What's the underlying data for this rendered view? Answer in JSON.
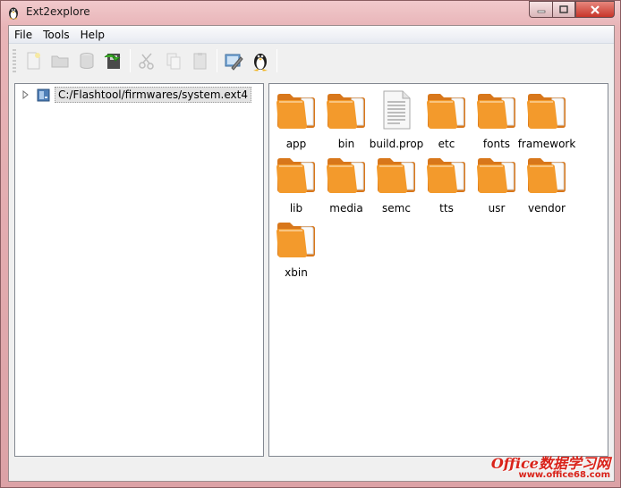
{
  "window": {
    "title": "Ext2explore"
  },
  "menu": {
    "items": [
      "File",
      "Tools",
      "Help"
    ]
  },
  "toolbar": {
    "buttons": [
      {
        "icon": "new-file-icon",
        "enabled": false
      },
      {
        "icon": "folder-icon",
        "enabled": false
      },
      {
        "icon": "disk-icon",
        "enabled": false
      },
      {
        "icon": "save-icon",
        "enabled": true
      },
      {
        "icon": "cut-icon",
        "enabled": false
      },
      {
        "icon": "copy-icon",
        "enabled": false
      },
      {
        "icon": "paste-icon",
        "enabled": false
      },
      {
        "icon": "settings-icon",
        "enabled": true
      },
      {
        "icon": "linux-penguin-icon",
        "enabled": true
      }
    ]
  },
  "tree": {
    "root_path": "C:/Flashtool/firmwares/system.ext4"
  },
  "files": [
    {
      "name": "app",
      "type": "folder"
    },
    {
      "name": "bin",
      "type": "folder"
    },
    {
      "name": "build.prop",
      "type": "file"
    },
    {
      "name": "etc",
      "type": "folder"
    },
    {
      "name": "fonts",
      "type": "folder"
    },
    {
      "name": "framework",
      "type": "folder"
    },
    {
      "name": "lib",
      "type": "folder"
    },
    {
      "name": "media",
      "type": "folder"
    },
    {
      "name": "semc",
      "type": "folder"
    },
    {
      "name": "tts",
      "type": "folder"
    },
    {
      "name": "usr",
      "type": "folder"
    },
    {
      "name": "vendor",
      "type": "folder"
    },
    {
      "name": "xbin",
      "type": "folder"
    }
  ],
  "watermark": {
    "main": "Office数据学习网",
    "sub": "www.office68.com"
  },
  "colors": {
    "folder": "#f39a2c",
    "folder_dark": "#d8771b",
    "title_close": "#c7352a"
  }
}
